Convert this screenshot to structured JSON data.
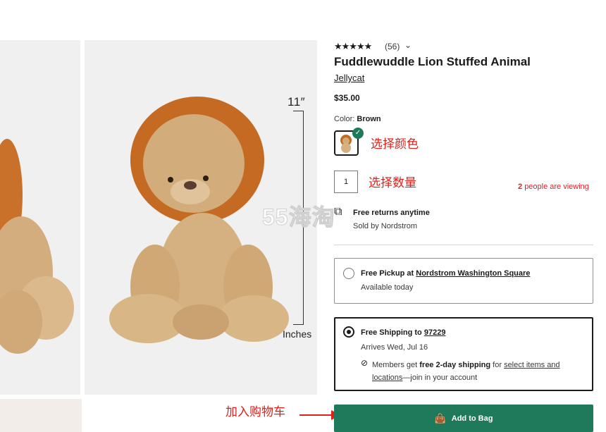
{
  "gallery": {
    "dimension_height": "11″",
    "dimension_unit": "Inches"
  },
  "product": {
    "stars": "★★★★★",
    "rating_count": "(56)",
    "title": "Fuddlewuddle Lion Stuffed Animal",
    "brand": "Jellycat",
    "price": "$35.00",
    "color_label": "Color:",
    "color_value": "Brown",
    "quantity": "1"
  },
  "annotations": {
    "select_color": "选择颜色",
    "select_quantity": "选择数量",
    "add_to_cart": "加入购物车"
  },
  "viewing": {
    "count": "2",
    "text": "people are viewing"
  },
  "watermark": "55海淘",
  "returns": {
    "label": "Free returns anytime",
    "sold_by": "Sold by Nordstrom"
  },
  "pickup": {
    "title_prefix": "Free Pickup at ",
    "store": "Nordstrom Washington Square",
    "subtitle": "Available today"
  },
  "shipping": {
    "title_prefix": "Free Shipping to ",
    "zip": "97229",
    "arrives": "Arrives Wed, Jul 16",
    "members_prefix": "Members get ",
    "members_bold": "free 2-day shipping",
    "members_mid": " for ",
    "members_link": "select items and locations",
    "members_suffix": "—join in your account"
  },
  "cta": {
    "add_to_bag": "Add to Bag"
  },
  "colors": {
    "accent": "#1f7a5b",
    "annotation": "#e0201a",
    "viewing": "#d8232a"
  }
}
